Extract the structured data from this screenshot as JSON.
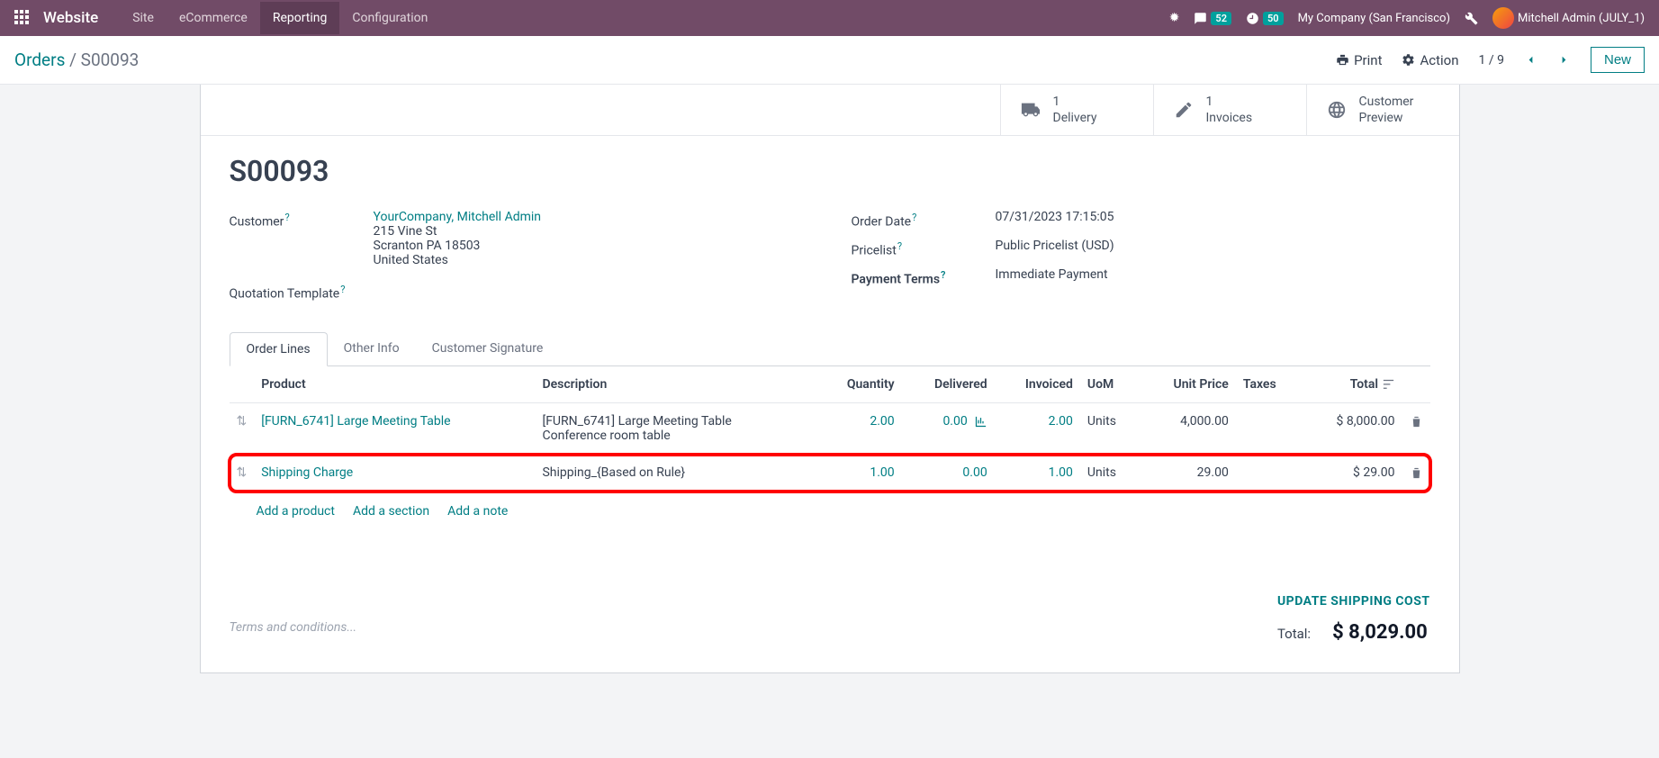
{
  "topnav": {
    "brand": "Website",
    "items": [
      "Site",
      "eCommerce",
      "Reporting",
      "Configuration"
    ],
    "active_index": 2,
    "msg_count": "52",
    "activity_count": "50",
    "company": "My Company (San Francisco)",
    "user": "Mitchell Admin (JULY_1)"
  },
  "breadcrumb": {
    "parent": "Orders",
    "current": "S00093",
    "print_label": "Print",
    "action_label": "Action",
    "pager": "1 / 9",
    "new_label": "New"
  },
  "stat_buttons": {
    "delivery": {
      "count": "1",
      "label": "Delivery"
    },
    "invoices": {
      "count": "1",
      "label": "Invoices"
    },
    "preview": {
      "label1": "Customer",
      "label2": "Preview"
    }
  },
  "order": {
    "title": "S00093",
    "customer_label": "Customer",
    "customer_name": "YourCompany, Mitchell Admin",
    "addr1": "215 Vine St",
    "addr2": "Scranton PA 18503",
    "addr3": "United States",
    "quotation_template_label": "Quotation Template",
    "order_date_label": "Order Date",
    "order_date": "07/31/2023 17:15:05",
    "pricelist_label": "Pricelist",
    "pricelist": "Public Pricelist (USD)",
    "payment_terms_label": "Payment Terms",
    "payment_terms": "Immediate Payment"
  },
  "tabs": [
    "Order Lines",
    "Other Info",
    "Customer Signature"
  ],
  "active_tab": 0,
  "table": {
    "headers": {
      "product": "Product",
      "description": "Description",
      "quantity": "Quantity",
      "delivered": "Delivered",
      "invoiced": "Invoiced",
      "uom": "UoM",
      "unit_price": "Unit Price",
      "taxes": "Taxes",
      "total": "Total"
    },
    "rows": [
      {
        "product": "[FURN_6741] Large Meeting Table",
        "desc1": "[FURN_6741] Large Meeting Table",
        "desc2": "Conference room table",
        "quantity": "2.00",
        "delivered": "0.00",
        "invoiced": "2.00",
        "uom": "Units",
        "unit_price": "4,000.00",
        "total": "$ 8,000.00",
        "linked": true,
        "chart": true
      },
      {
        "product": "Shipping Charge",
        "desc1": "Shipping_{Based on Rule}",
        "desc2": "",
        "quantity": "1.00",
        "delivered": "0.00",
        "invoiced": "1.00",
        "uom": "Units",
        "unit_price": "29.00",
        "total": "$ 29.00",
        "linked": true,
        "chart": false,
        "highlighted": true
      }
    ]
  },
  "line_actions": {
    "add_product": "Add a product",
    "add_section": "Add a section",
    "add_note": "Add a note"
  },
  "totals": {
    "update_shipping": "UPDATE SHIPPING COST",
    "total_label": "Total:",
    "total_value": "$ 8,029.00"
  },
  "terms_placeholder": "Terms and conditions..."
}
